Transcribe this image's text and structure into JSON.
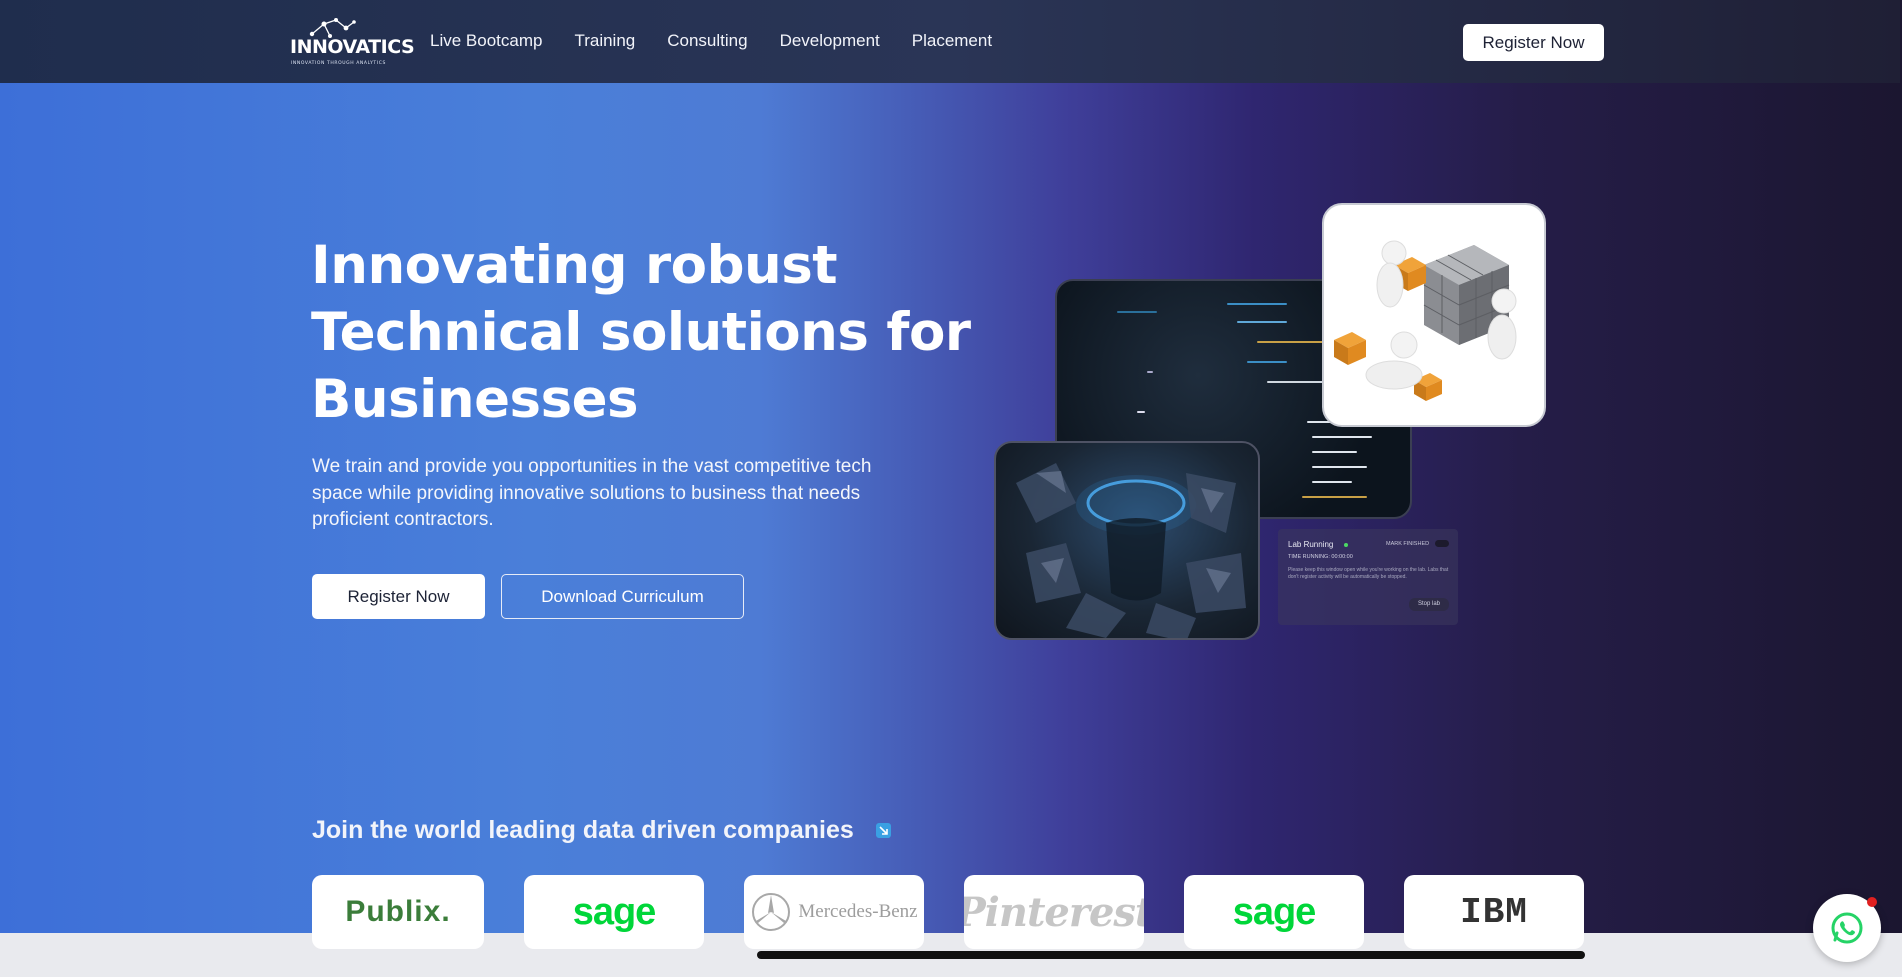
{
  "nav": {
    "logo_text": "INNOVATICS",
    "logo_tagline": "INNOVATION THROUGH ANALYTICS",
    "links": [
      "Live Bootcamp",
      "Training",
      "Consulting",
      "Development",
      "Placement"
    ],
    "cta": "Register Now"
  },
  "hero": {
    "title": "Innovating robust Technical solutions for Businesses",
    "subtitle": "We train and provide you opportunities in the vast competitive tech space while providing innovative solutions to business that needs proficient contractors.",
    "primary_button": "Register Now",
    "secondary_button": "Download Curriculum"
  },
  "lab_panel": {
    "title": "Lab Running",
    "mark_finished": "MARK FINISHED",
    "time_running": "TIME RUNNING:   00:00:00",
    "note": "Please keep this window open while you're working on the lab. Labs that don't register activity will be automatically be stopped.",
    "stop": "Stop lab"
  },
  "companies": {
    "heading": "Join the world leading data driven companies",
    "logos": [
      "Publix.",
      "sage",
      "Mercedes-Benz",
      "Pinterest",
      "sage",
      "IBM"
    ]
  },
  "colors": {
    "publix_green": "#3b7d3a",
    "sage_green": "#00d639",
    "whatsapp_green": "#25d366"
  }
}
